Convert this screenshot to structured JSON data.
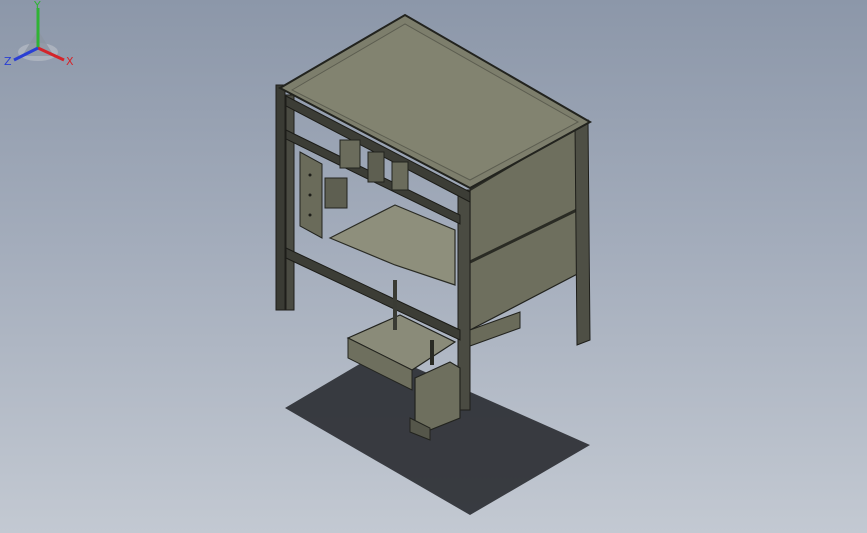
{
  "viewport": {
    "background_top": "#8c97a9",
    "background_bottom": "#c3c9d2"
  },
  "model": {
    "frame_color": "#3c3d36",
    "panel_color": "#6f705f",
    "panel_light_color": "#8a8b78",
    "shadow_color": "#2b2e33"
  },
  "triad": {
    "x_label": "X",
    "y_label": "Y",
    "z_label": "Z",
    "x_color": "#d4242a",
    "y_color": "#2fb335",
    "z_color": "#2a3fd4"
  }
}
